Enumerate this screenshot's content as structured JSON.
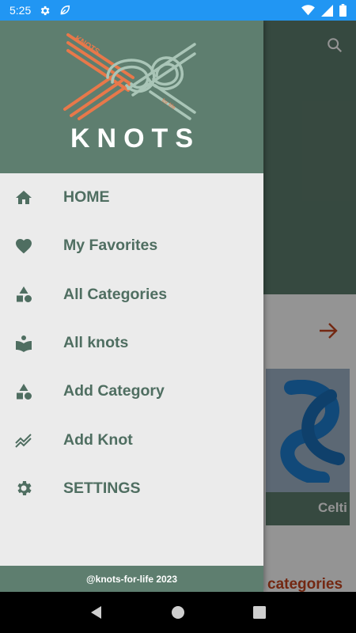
{
  "status_bar": {
    "time": "5:25",
    "icons": [
      "settings-gear-icon",
      "leaf-icon",
      "wifi-icon",
      "signal-icon",
      "battery-icon"
    ]
  },
  "background": {
    "search_icon": "search-icon",
    "arrow_icon": "arrow-right-icon",
    "card_label": "Celti",
    "section_title": "categories"
  },
  "drawer": {
    "logo_text": "KNOTS",
    "logo_tagline": "for life",
    "brand": "KNOTS",
    "menu": [
      {
        "label": "HOME",
        "icon": "home-icon"
      },
      {
        "label": "My Favorites",
        "icon": "heart-icon"
      },
      {
        "label": "All Categories",
        "icon": "category-icon"
      },
      {
        "label": "All knots",
        "icon": "book-reader-icon"
      },
      {
        "label": "Add Category",
        "icon": "category-icon"
      },
      {
        "label": "Add Knot",
        "icon": "trending-icon"
      },
      {
        "label": "SETTINGS",
        "icon": "settings-icon"
      }
    ],
    "footer": "@knots-for-life 2023"
  },
  "nav_bar": {
    "buttons": [
      "back-icon",
      "home-circle-icon",
      "recents-square-icon"
    ]
  },
  "colors": {
    "status_bar": "#2196f3",
    "drawer_header": "#5e7e6f",
    "drawer_bg": "#ebebeb",
    "menu_text": "#4f6e61",
    "logo_orange": "#e8784a",
    "accent_red": "#c7461f"
  }
}
